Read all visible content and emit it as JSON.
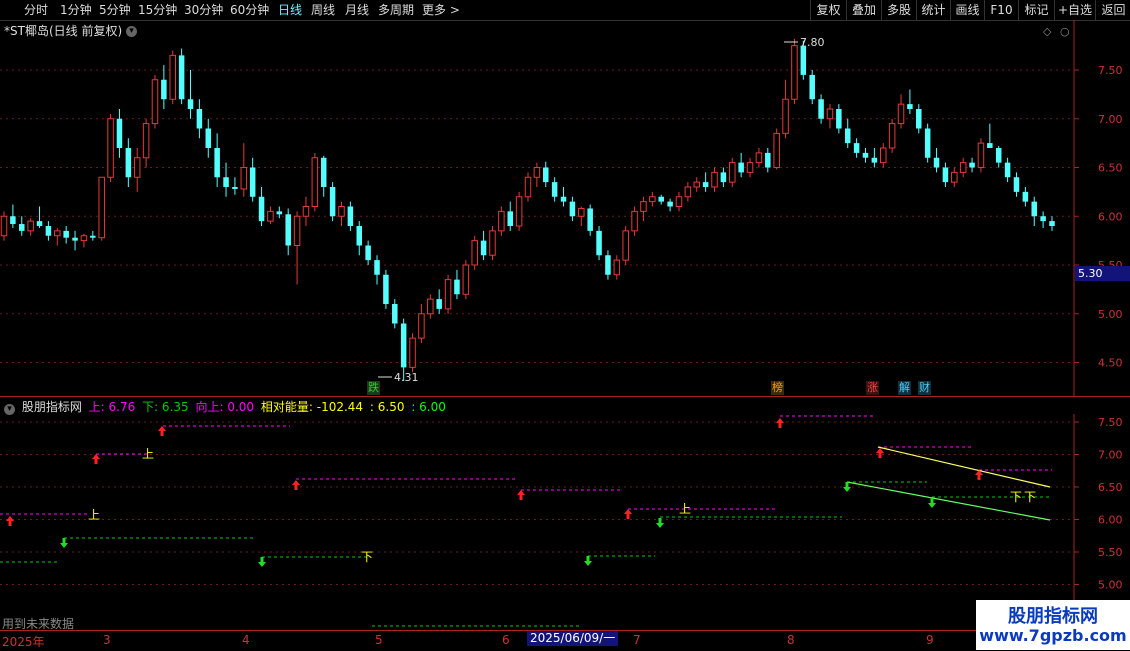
{
  "toolbar": {
    "periods": [
      "分时",
      "1分钟",
      "5分钟",
      "15分钟",
      "30分钟",
      "60分钟",
      "日线",
      "周线",
      "月线",
      "多周期",
      "更多 >"
    ],
    "active": "日线",
    "right_buttons": [
      "复权",
      "叠加",
      "多股",
      "统计",
      "画线",
      "F10",
      "标记",
      "+自选",
      "返回"
    ]
  },
  "chart_title": "*ST椰岛(日线 前复权)",
  "price_axis": [
    "7.50",
    "7.00",
    "6.50",
    "6.00",
    "5.50",
    "5.00",
    "4.50"
  ],
  "current_price": "5.30",
  "annotations": {
    "high": "7.80",
    "low": "4.31"
  },
  "badges": [
    {
      "text": "跌",
      "color": "#3c3",
      "bg": "#1a3a1a"
    },
    {
      "text": "榜",
      "color": "#f90",
      "bg": "#3a2a10"
    },
    {
      "text": "涨",
      "color": "#f44",
      "bg": "#3a1010"
    },
    {
      "text": "解",
      "color": "#4cf",
      "bg": "#10303a"
    },
    {
      "text": "财",
      "color": "#4cf",
      "bg": "#10303a"
    }
  ],
  "indicator": {
    "name": "股朋指标网",
    "up_label": "上: 6.76",
    "down_label": "下: 6.35",
    "xiang_label": "向上: 0.00",
    "energy_label": "相对能量: -102.44",
    "v1": ": 6.50",
    "v2": ": 6.00",
    "axis": [
      "7.50",
      "7.00",
      "6.50",
      "6.00",
      "5.50",
      "5.00"
    ],
    "text_marks": {
      "up": "上",
      "down": "下"
    },
    "colors": {
      "up": "#f0f",
      "down": "#0c0",
      "xiang": "#f0f",
      "energy": "#ff0",
      "v1": "#ff0",
      "v2": "#0f0"
    }
  },
  "future_note": "用到未来数据",
  "date_axis": [
    "2025年",
    "3",
    "4",
    "5",
    "6",
    "7",
    "8",
    "9"
  ],
  "date_cursor": "2025/06/09/一",
  "watermark": {
    "title": "股朋指标网",
    "url": "www.7gpzb.com"
  },
  "chart_data": {
    "type": "candlestick",
    "title": "*ST椰岛(日线 前复权)",
    "ylim": [
      4.2,
      7.9
    ],
    "candles": [
      [
        5.8,
        6.05,
        5.75,
        6.0
      ],
      [
        6.0,
        6.12,
        5.88,
        5.92
      ],
      [
        5.92,
        6.0,
        5.8,
        5.85
      ],
      [
        5.85,
        5.98,
        5.8,
        5.95
      ],
      [
        5.95,
        6.1,
        5.88,
        5.9
      ],
      [
        5.9,
        5.95,
        5.75,
        5.8
      ],
      [
        5.8,
        5.88,
        5.7,
        5.85
      ],
      [
        5.85,
        5.9,
        5.72,
        5.78
      ],
      [
        5.78,
        5.85,
        5.65,
        5.75
      ],
      [
        5.75,
        5.82,
        5.68,
        5.8
      ],
      [
        5.8,
        5.85,
        5.75,
        5.78
      ],
      [
        5.78,
        6.4,
        5.75,
        6.4
      ],
      [
        6.4,
        7.05,
        6.35,
        7.0
      ],
      [
        7.0,
        7.1,
        6.6,
        6.7
      ],
      [
        6.7,
        6.8,
        6.3,
        6.4
      ],
      [
        6.4,
        6.7,
        6.25,
        6.6
      ],
      [
        6.6,
        7.0,
        6.5,
        6.95
      ],
      [
        6.95,
        7.45,
        6.9,
        7.4
      ],
      [
        7.4,
        7.55,
        7.1,
        7.2
      ],
      [
        7.2,
        7.7,
        7.15,
        7.65
      ],
      [
        7.65,
        7.72,
        7.15,
        7.2
      ],
      [
        7.2,
        7.5,
        7.0,
        7.1
      ],
      [
        7.1,
        7.2,
        6.8,
        6.9
      ],
      [
        6.9,
        7.0,
        6.6,
        6.7
      ],
      [
        6.7,
        6.85,
        6.3,
        6.4
      ],
      [
        6.4,
        6.55,
        6.2,
        6.3
      ],
      [
        6.3,
        6.4,
        6.22,
        6.28
      ],
      [
        6.28,
        6.75,
        6.2,
        6.5
      ],
      [
        6.5,
        6.6,
        6.15,
        6.2
      ],
      [
        6.2,
        6.3,
        5.9,
        5.95
      ],
      [
        5.95,
        6.1,
        5.92,
        6.05
      ],
      [
        6.05,
        6.1,
        5.98,
        6.02
      ],
      [
        6.02,
        6.08,
        5.6,
        5.7
      ],
      [
        5.7,
        6.05,
        5.3,
        6.0
      ],
      [
        6.0,
        6.2,
        5.9,
        6.1
      ],
      [
        6.1,
        6.65,
        6.05,
        6.6
      ],
      [
        6.6,
        6.62,
        6.2,
        6.3
      ],
      [
        6.3,
        6.35,
        5.95,
        6.0
      ],
      [
        6.0,
        6.15,
        5.9,
        6.1
      ],
      [
        6.1,
        6.15,
        5.85,
        5.9
      ],
      [
        5.9,
        5.95,
        5.6,
        5.7
      ],
      [
        5.7,
        5.75,
        5.5,
        5.55
      ],
      [
        5.55,
        5.6,
        5.3,
        5.4
      ],
      [
        5.4,
        5.45,
        5.05,
        5.1
      ],
      [
        5.1,
        5.15,
        4.85,
        4.9
      ],
      [
        4.9,
        4.95,
        4.31,
        4.45
      ],
      [
        4.45,
        4.8,
        4.4,
        4.75
      ],
      [
        4.75,
        5.1,
        4.7,
        5.0
      ],
      [
        5.0,
        5.2,
        4.95,
        5.15
      ],
      [
        5.15,
        5.25,
        5.0,
        5.05
      ],
      [
        5.05,
        5.4,
        5.0,
        5.35
      ],
      [
        5.35,
        5.45,
        5.15,
        5.2
      ],
      [
        5.2,
        5.55,
        5.15,
        5.5
      ],
      [
        5.5,
        5.8,
        5.45,
        5.75
      ],
      [
        5.75,
        5.85,
        5.55,
        5.6
      ],
      [
        5.6,
        5.9,
        5.55,
        5.85
      ],
      [
        5.85,
        6.1,
        5.8,
        6.05
      ],
      [
        6.05,
        6.15,
        5.85,
        5.9
      ],
      [
        5.9,
        6.25,
        5.85,
        6.2
      ],
      [
        6.2,
        6.45,
        6.15,
        6.4
      ],
      [
        6.4,
        6.55,
        6.3,
        6.5
      ],
      [
        6.5,
        6.56,
        6.3,
        6.35
      ],
      [
        6.35,
        6.4,
        6.15,
        6.2
      ],
      [
        6.2,
        6.3,
        6.1,
        6.15
      ],
      [
        6.15,
        6.2,
        5.95,
        6.0
      ],
      [
        6.0,
        6.1,
        5.9,
        6.08
      ],
      [
        6.08,
        6.12,
        5.8,
        5.85
      ],
      [
        5.85,
        5.9,
        5.55,
        5.6
      ],
      [
        5.6,
        5.65,
        5.35,
        5.4
      ],
      [
        5.4,
        5.6,
        5.35,
        5.55
      ],
      [
        5.55,
        5.9,
        5.5,
        5.85
      ],
      [
        5.85,
        6.1,
        5.8,
        6.05
      ],
      [
        6.05,
        6.2,
        5.95,
        6.15
      ],
      [
        6.15,
        6.25,
        6.1,
        6.2
      ],
      [
        6.2,
        6.22,
        6.12,
        6.15
      ],
      [
        6.15,
        6.18,
        6.05,
        6.1
      ],
      [
        6.1,
        6.25,
        6.05,
        6.2
      ],
      [
        6.2,
        6.35,
        6.15,
        6.3
      ],
      [
        6.3,
        6.4,
        6.25,
        6.35
      ],
      [
        6.35,
        6.45,
        6.25,
        6.3
      ],
      [
        6.3,
        6.5,
        6.25,
        6.45
      ],
      [
        6.45,
        6.5,
        6.3,
        6.35
      ],
      [
        6.35,
        6.6,
        6.3,
        6.55
      ],
      [
        6.55,
        6.65,
        6.4,
        6.45
      ],
      [
        6.45,
        6.6,
        6.4,
        6.55
      ],
      [
        6.55,
        6.7,
        6.5,
        6.65
      ],
      [
        6.65,
        6.7,
        6.45,
        6.5
      ],
      [
        6.5,
        6.9,
        6.48,
        6.85
      ],
      [
        6.85,
        7.4,
        6.8,
        7.2
      ],
      [
        7.2,
        7.82,
        7.15,
        7.75
      ],
      [
        7.75,
        7.8,
        7.4,
        7.45
      ],
      [
        7.45,
        7.5,
        7.15,
        7.2
      ],
      [
        7.2,
        7.25,
        6.95,
        7.0
      ],
      [
        7.0,
        7.15,
        6.9,
        7.1
      ],
      [
        7.1,
        7.15,
        6.85,
        6.9
      ],
      [
        6.9,
        7.0,
        6.7,
        6.75
      ],
      [
        6.75,
        6.8,
        6.6,
        6.65
      ],
      [
        6.65,
        6.7,
        6.55,
        6.6
      ],
      [
        6.6,
        6.7,
        6.5,
        6.55
      ],
      [
        6.55,
        6.75,
        6.5,
        6.7
      ],
      [
        6.7,
        7.0,
        6.65,
        6.95
      ],
      [
        6.95,
        7.25,
        6.9,
        7.15
      ],
      [
        7.15,
        7.3,
        7.05,
        7.1
      ],
      [
        7.1,
        7.15,
        6.85,
        6.9
      ],
      [
        6.9,
        6.95,
        6.55,
        6.6
      ],
      [
        6.6,
        6.7,
        6.45,
        6.5
      ],
      [
        6.5,
        6.55,
        6.3,
        6.35
      ],
      [
        6.35,
        6.5,
        6.3,
        6.45
      ],
      [
        6.45,
        6.6,
        6.4,
        6.55
      ],
      [
        6.55,
        6.6,
        6.45,
        6.5
      ],
      [
        6.5,
        6.8,
        6.45,
        6.75
      ],
      [
        6.75,
        6.95,
        6.7,
        6.7
      ],
      [
        6.7,
        6.72,
        6.5,
        6.55
      ],
      [
        6.55,
        6.6,
        6.35,
        6.4
      ],
      [
        6.4,
        6.45,
        6.2,
        6.25
      ],
      [
        6.25,
        6.3,
        6.1,
        6.15
      ],
      [
        6.15,
        6.2,
        5.9,
        6.0
      ],
      [
        6.0,
        6.05,
        5.88,
        5.95
      ],
      [
        5.95,
        6.0,
        5.85,
        5.9
      ]
    ]
  }
}
